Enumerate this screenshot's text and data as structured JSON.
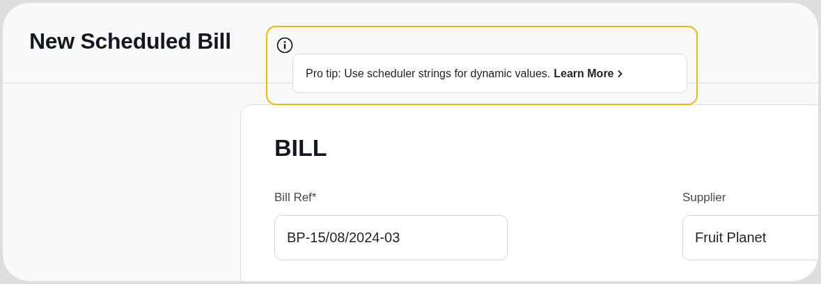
{
  "page": {
    "title": "New Scheduled Bill"
  },
  "tooltip": {
    "highlighted": true,
    "text": "Pro tip: Use scheduler strings for dynamic values.",
    "link": "Learn More"
  },
  "card": {
    "heading": "BILL",
    "fields": [
      {
        "label": "Bill Ref*",
        "value": "BP-15/08/2024-03"
      },
      {
        "label": "Supplier",
        "value": "Fruit Planet"
      }
    ]
  }
}
